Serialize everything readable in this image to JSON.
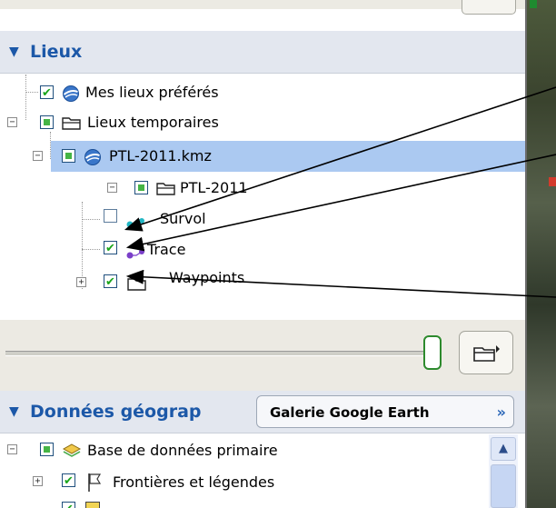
{
  "places_panel": {
    "title": "Lieux",
    "items": [
      {
        "label": "Mes lieux préférés"
      },
      {
        "label": "Lieux temporaires"
      },
      {
        "label": "PTL-2011.kmz"
      },
      {
        "label": "PTL-2011"
      },
      {
        "label": "Survol"
      },
      {
        "label": "Trace"
      },
      {
        "label": "Waypoints"
      }
    ]
  },
  "layers_panel": {
    "title": "Données géograp",
    "gallery_button": "Galerie Google Earth",
    "gallery_chevron": "»",
    "items": [
      {
        "label": "Base de données primaire"
      },
      {
        "label": "Frontières et légendes"
      }
    ]
  },
  "icons": {
    "collapse": "−",
    "expand": "+",
    "triangle": "▼",
    "scroll_up": "▲"
  },
  "colors": {
    "accent": "#1c58a8",
    "selection": "#abc9f1",
    "check_green": "#1aa51a"
  }
}
